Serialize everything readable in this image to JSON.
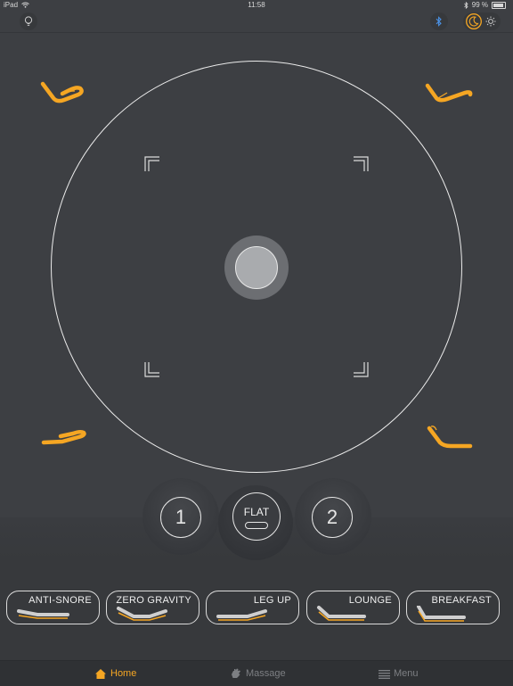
{
  "status": {
    "device": "iPad",
    "time": "11:58",
    "battery": "99 %"
  },
  "icons": {
    "bulb": "lightbulb-icon",
    "bluetooth": "bluetooth-icon",
    "night": "moon-icon",
    "day": "sun-icon"
  },
  "colors": {
    "accent": "#f5a623",
    "background": "#3d3f43"
  },
  "memory": {
    "one": "1",
    "two": "2"
  },
  "flat": {
    "label": "FLAT"
  },
  "presets": [
    {
      "label": "ANTI-SNORE"
    },
    {
      "label": "ZERO GRAVITY"
    },
    {
      "label": "LEG UP"
    },
    {
      "label": "LOUNGE"
    },
    {
      "label": "BREAKFAST"
    }
  ],
  "tabs": [
    {
      "label": "Home",
      "active": true
    },
    {
      "label": "Massage",
      "active": false
    },
    {
      "label": "Menu",
      "active": false
    }
  ]
}
